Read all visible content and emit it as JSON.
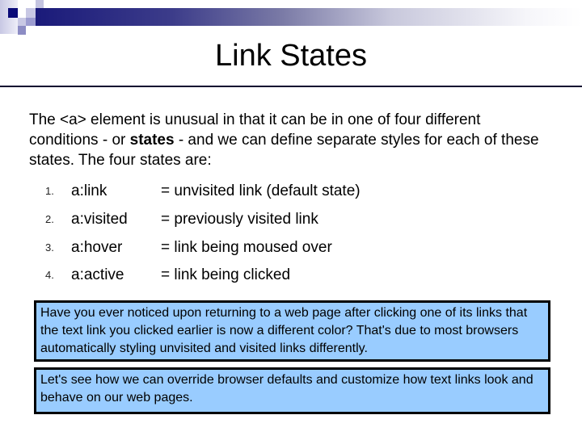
{
  "slide": {
    "title": "Link States",
    "intro": {
      "part1": "The <a> element is unusual in that it can be in one of four different conditions - or ",
      "bold": "states",
      "part2": " - and we can define separate styles for each of these states.  The four states are:"
    },
    "states": [
      {
        "number": "1.",
        "selector": "a:link",
        "description": "= unvisited link (default state)"
      },
      {
        "number": "2.",
        "selector": "a:visited",
        "description": "= previously visited link"
      },
      {
        "number": "3.",
        "selector": "a:hover",
        "description": "= link being moused over"
      },
      {
        "number": "4.",
        "selector": "a:active",
        "description": "= link being clicked"
      }
    ],
    "notes": [
      "Have you ever noticed upon returning to a web page after clicking one of its links that the text link you clicked earlier is now a different color?  That's due to most browsers automatically styling unvisited and visited links differently.",
      "Let's see how we can override browser defaults and customize how text links look and behave on our web pages."
    ]
  },
  "colors": {
    "note_background": "#99ccff",
    "header_accent": "#1a1a7a",
    "divider": "#0c0830"
  }
}
